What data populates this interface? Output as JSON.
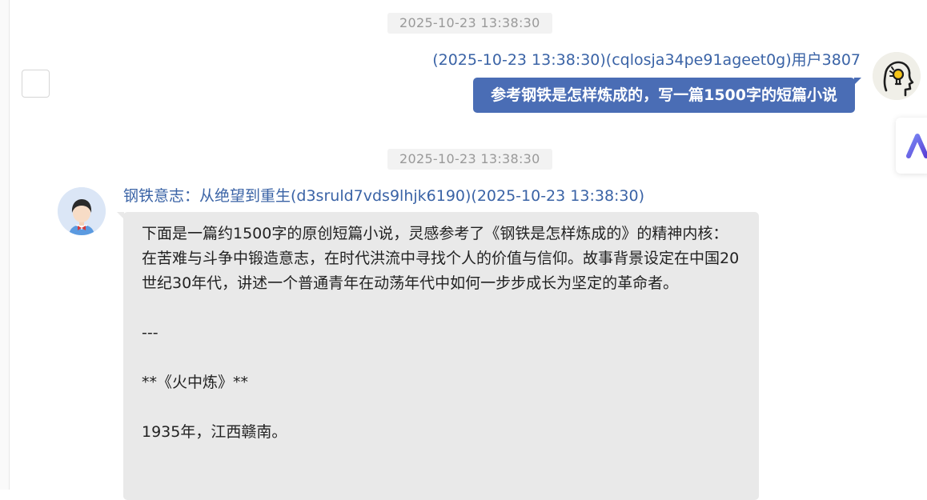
{
  "messages": {
    "user": {
      "timestamp": "2025-10-23 13:38:30",
      "header": "(2025-10-23 13:38:30)(cqlosja34pe91ageet0g)用户3807",
      "text": "参考钢铁是怎样炼成的，写一篇1500字的短篇小说"
    },
    "bot": {
      "timestamp": "2025-10-23 13:38:30",
      "header": "钢铁意志：从绝望到重生(d3sruld7vds9lhjk6190)(2025-10-23 13:38:30)",
      "paragraphs": [
        "下面是一篇约1500字的原创短篇小说，灵感参考了《钢铁是怎样炼成的》的精神内核：在苦难与斗争中锻造意志，在时代洪流中寻找个人的价值与信仰。故事背景设定在中国20世纪30年代，讲述一个普通青年在动荡年代中如何一步步成长为坚定的革命者。",
        "---",
        "**《火中炼》**",
        "1935年，江西赣南。"
      ]
    }
  },
  "icons": {
    "user_avatar": "lightbulb-head-icon",
    "bot_avatar": "person-bowtie-icon",
    "side_widget": "a-logo-icon"
  },
  "colors": {
    "user_bubble": "#4a6db5",
    "header_text": "#3a63a6",
    "bot_bubble": "#e9e9e9",
    "timestamp_bg": "#f2f2f2"
  }
}
